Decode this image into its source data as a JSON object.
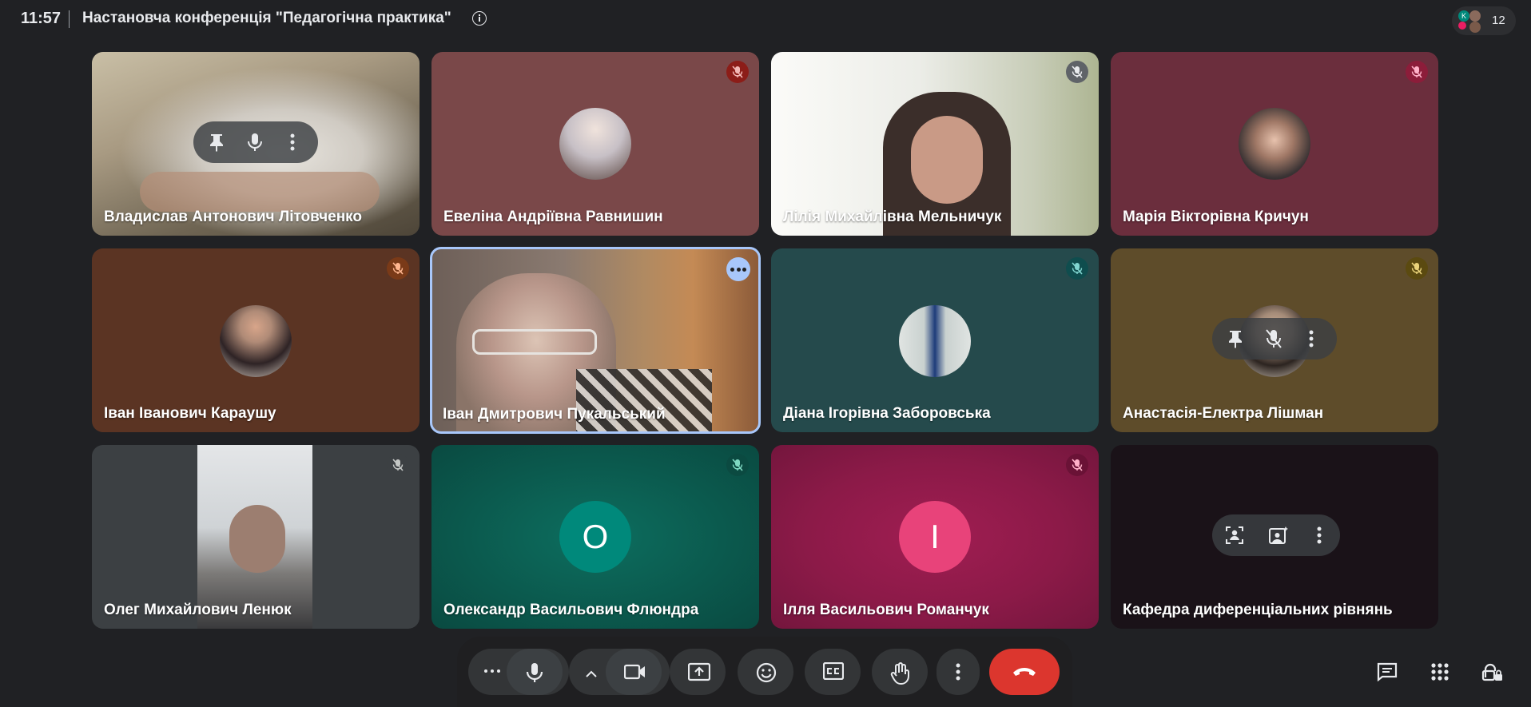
{
  "meeting": {
    "time": "11:57",
    "title": "Настановча конференція \"Педагогічна практика\"",
    "participant_count": "12"
  },
  "tiles": [
    {
      "name": "Владислав Антонович Літовченко",
      "muted": false
    },
    {
      "name": "Евеліна Андріївна Равнишин",
      "muted": true
    },
    {
      "name": "Лілія Михайлівна Мельничук",
      "muted": true
    },
    {
      "name": "Марія Вікторівна Кричун",
      "muted": true
    },
    {
      "name": "Іван Іванович Караушу",
      "muted": true
    },
    {
      "name": "Іван Дмитрович Пукальський",
      "muted": false
    },
    {
      "name": "Діана Ігорівна Заборовська",
      "muted": true
    },
    {
      "name": "Анастасія-Електра Лішман",
      "muted": true
    },
    {
      "name": "Олег Михайлович Ленюк",
      "muted": true
    },
    {
      "name": "Олександр Васильович Флюндра",
      "muted": true,
      "initial": "О"
    },
    {
      "name": "Ілля Васильович Романчук",
      "muted": true,
      "initial": "І"
    },
    {
      "name": "Кафедра диференціальних рівнянь",
      "muted": false
    }
  ],
  "icons": {
    "info": "info-icon",
    "pin": "pin-icon",
    "mic": "mic-icon",
    "mic_off": "mic-off-icon",
    "more": "more-vert-icon",
    "camera": "videocam-icon",
    "present": "present-to-all-icon",
    "emoji": "emoji-icon",
    "captions": "closed-captions-icon",
    "raise_hand": "raise-hand-icon",
    "hang_up": "call-end-icon",
    "chat": "chat-icon",
    "activities": "apps-icon",
    "host_controls": "host-controls-lock-icon"
  },
  "colors": {
    "background": "#202124",
    "end_call": "#dc362e",
    "active_speaker_border": "#a8c7fa"
  }
}
